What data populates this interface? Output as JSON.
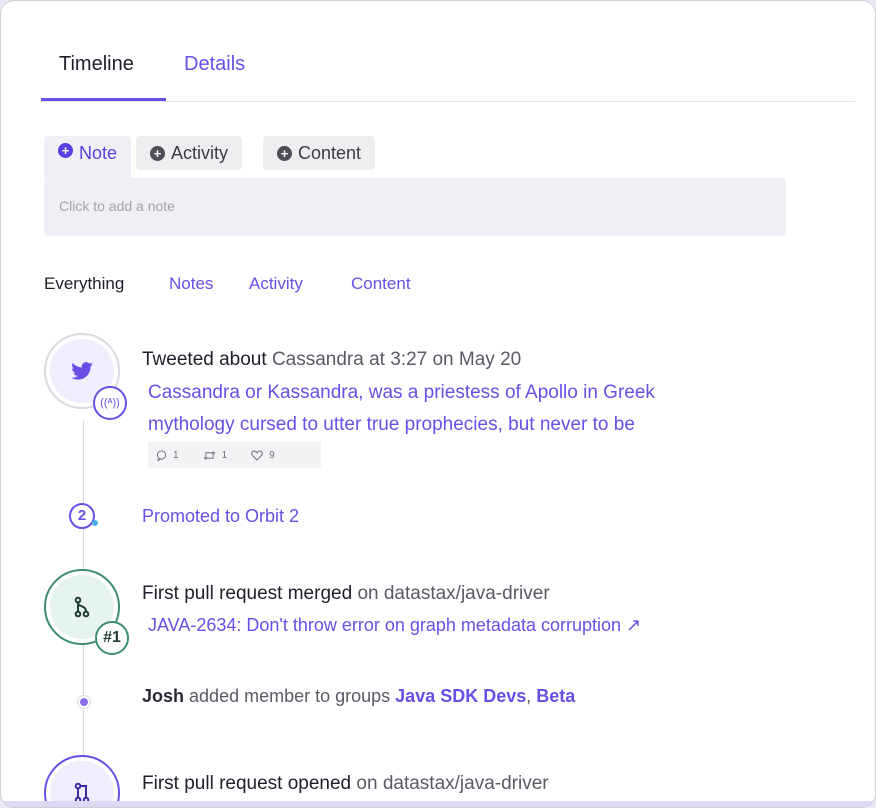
{
  "tabs": [
    {
      "label": "Timeline",
      "active": true
    },
    {
      "label": "Details",
      "active": false
    }
  ],
  "add_chips": [
    {
      "label": "Note",
      "active": true
    },
    {
      "label": "Activity",
      "active": false
    },
    {
      "label": "Content",
      "active": false
    }
  ],
  "note": {
    "placeholder": "Click to add a note"
  },
  "filters": [
    "Everything",
    "Notes",
    "Activity",
    "Content"
  ],
  "colors": {
    "accent": "#6b4ee6",
    "green": "#3e8d6e",
    "twitter": "#6b4ee6"
  },
  "activities": {
    "tweet": {
      "icon": "twitter-icon",
      "badge_icon": "broadcast-icon",
      "title_bold": "Tweeted about",
      "title_rest": "Cassandra at 3:27 on May 20",
      "body_line1": "Cassandra or Kassandra, was a priestess of Apollo in Greek",
      "body_line2": "mythology cursed to utter true prophecies, but never to be",
      "replies": "1",
      "retweets": "1",
      "likes": "9"
    },
    "orbit": {
      "level": "2",
      "text": "Promoted to Orbit 2"
    },
    "pr_merged": {
      "icon": "merge-icon",
      "badge": "#1",
      "title_bold": "First pull request merged",
      "title_rest": "on datastax/java-driver",
      "link": "JAVA-2634: Don't throw error on graph metadata corruption ↗"
    },
    "member": {
      "actor": "Josh",
      "text": "added member to groups",
      "group1": "Java SDK Devs",
      "separator": ",",
      "group2": "Beta"
    },
    "pr_opened": {
      "icon": "pull-request-icon",
      "title_bold": "First pull request opened",
      "title_rest": "on datastax/java-driver"
    }
  }
}
